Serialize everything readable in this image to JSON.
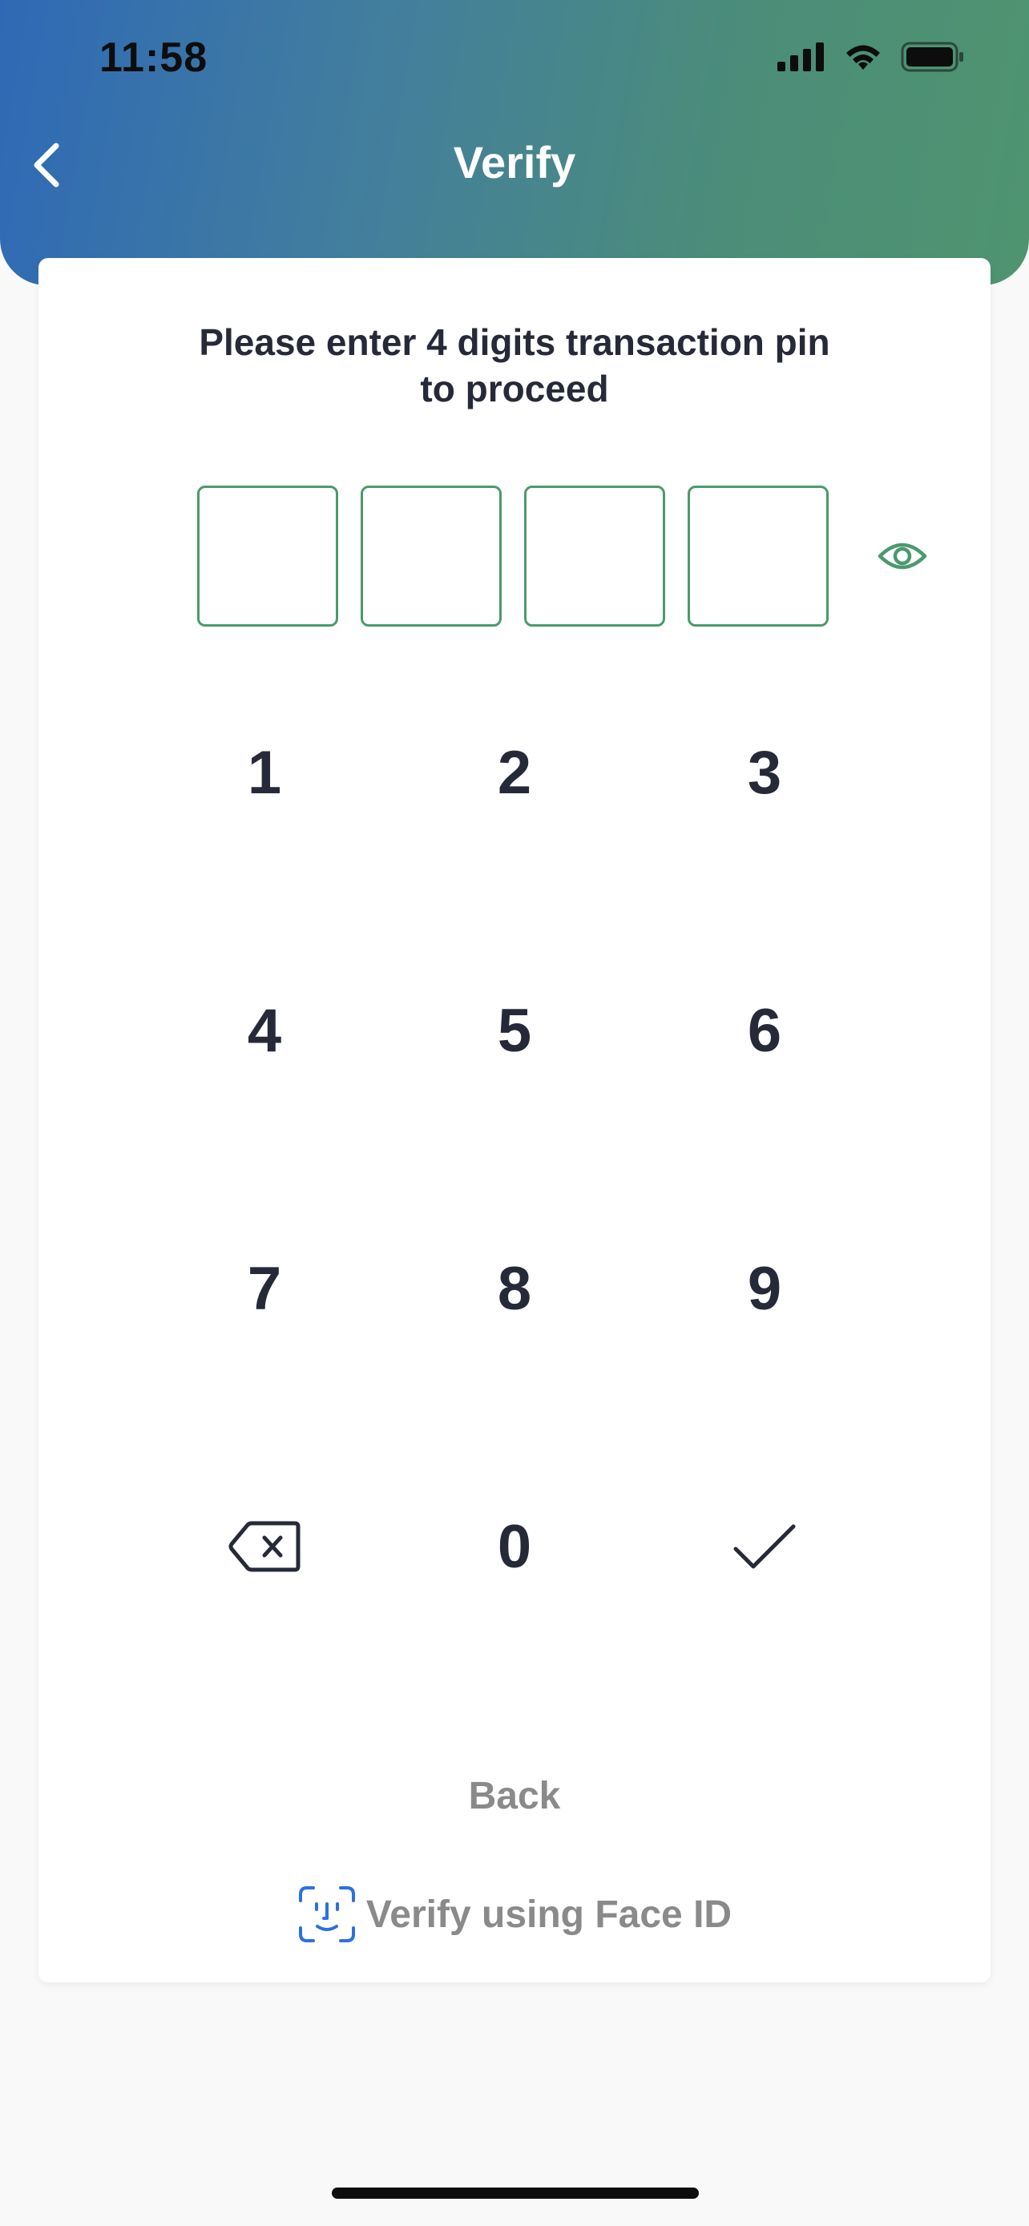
{
  "status_bar": {
    "time": "11:58",
    "icons": [
      "signal-icon",
      "wifi-icon",
      "battery-icon"
    ]
  },
  "header": {
    "title": "Verify",
    "back_icon": "chevron-left-icon",
    "gradient": [
      "#2f69b6",
      "#4f9470"
    ]
  },
  "prompt": {
    "line1": "Please enter 4 digits transaction pin",
    "line2": "to proceed"
  },
  "pin": {
    "length": 4,
    "entered_digits": 0,
    "border_color": "#4a9a6d",
    "toggle_icon": "eye-icon"
  },
  "keypad": {
    "keys": [
      "1",
      "2",
      "3",
      "4",
      "5",
      "6",
      "7",
      "8",
      "9",
      "0"
    ],
    "delete_icon": "backspace-icon",
    "confirm_icon": "checkmark-icon"
  },
  "links": {
    "back": "Back",
    "face_id": "Verify using Face ID",
    "face_id_icon": "face-id-icon",
    "face_id_icon_color": "#2f6fe0"
  },
  "colors": {
    "text": "#262a38",
    "muted": "#8a8a8a",
    "accent": "#4a9a6d"
  }
}
